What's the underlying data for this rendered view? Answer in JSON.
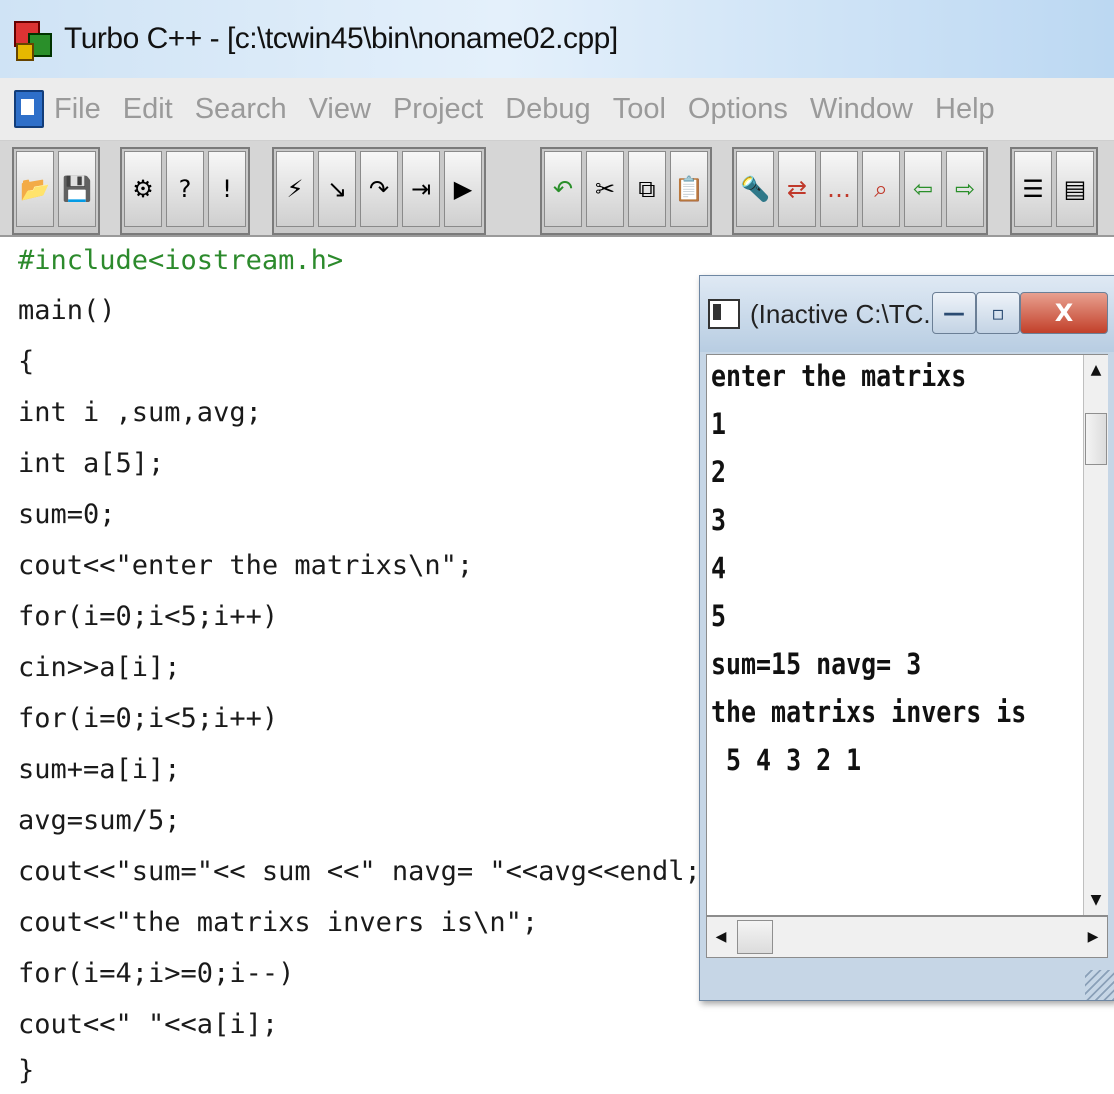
{
  "window": {
    "title": "Turbo C++ - [c:\\tcwin45\\bin\\noname02.cpp]"
  },
  "menu": {
    "items": [
      "File",
      "Edit",
      "Search",
      "View",
      "Project",
      "Debug",
      "Tool",
      "Options",
      "Window",
      "Help"
    ]
  },
  "toolbar": {
    "icons": [
      "open-file-icon",
      "save-file-icon",
      "compile-icon",
      "make-icon",
      "build-icon",
      "lightning-icon",
      "step-into-icon",
      "step-over-icon",
      "run-to-icon",
      "run-icon",
      "undo-icon",
      "cut-icon",
      "copy-icon",
      "paste-icon",
      "search-icon",
      "replace-icon",
      "search-again-icon",
      "browse-icon",
      "previous-message-icon",
      "next-message-icon",
      "window-tile-icon",
      "window-cascade-icon"
    ]
  },
  "editor": {
    "lines": [
      "#include<iostream.h>",
      "main()",
      "{",
      "int i ,sum,avg;",
      "int a[5];",
      "sum=0;",
      "cout<<\"enter the matrixs\\n\";",
      "for(i=0;i<5;i++)",
      "cin>>a[i];",
      "for(i=0;i<5;i++)",
      "sum+=a[i];",
      "avg=sum/5;",
      "cout<<\"sum=\"<< sum <<\" navg= \"<<avg<<endl;",
      "cout<<\"the matrixs invers is\\n\";",
      "for(i=4;i>=0;i--)",
      "cout<<\" \"<<a[i];",
      "}"
    ]
  },
  "console": {
    "title": "(Inactive C:\\TC...",
    "minimize": "—",
    "maximize": "▫",
    "close": "X",
    "output": [
      "enter the matrixs",
      "1",
      "2",
      "3",
      "4",
      "5",
      "sum=15 navg= 3",
      "the matrixs invers is",
      " 5 4 3 2 1"
    ]
  }
}
